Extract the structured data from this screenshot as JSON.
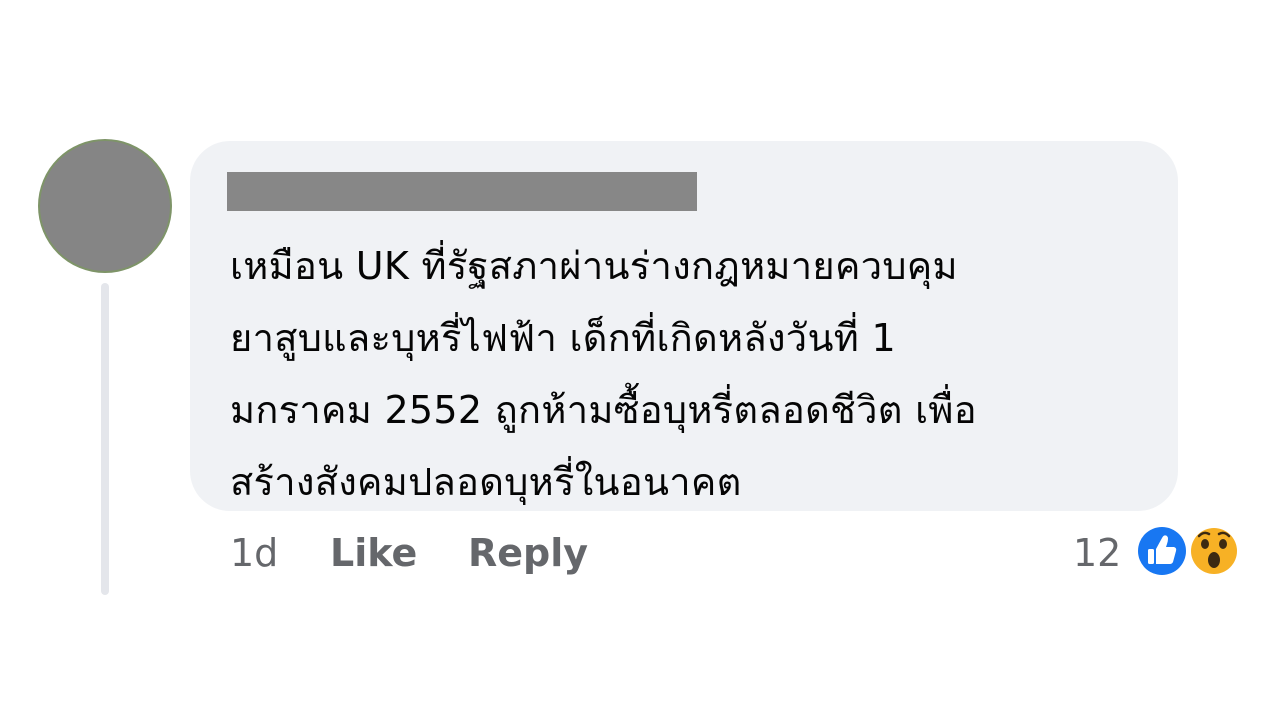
{
  "comment": {
    "author_name": "",
    "lines": [
      "เหมือน UK ที่รัฐสภาผ่านร่างกฎหมายควบคุม",
      "ยาสูบและบุหรี่ไฟฟ้า เด็กที่เกิดหลังวันที่ 1",
      "มกราคม 2552 ถูกห้ามซื้อบุหรี่ตลอดชีวิต เพื่อ",
      "สร้างสังคมปลอดบุหรี่ในอนาคต"
    ],
    "timestamp": "1d",
    "like_label": "Like",
    "reply_label": "Reply"
  },
  "reactions": {
    "count": "12",
    "icons": [
      "like-icon",
      "wow-icon"
    ],
    "colors": {
      "like": "#1877f2",
      "wow": "#f7b125"
    }
  },
  "colors": {
    "bubble": "#f0f2f5",
    "text": "#050505",
    "meta": "#65676b",
    "thread_line": "#e4e6eb"
  }
}
